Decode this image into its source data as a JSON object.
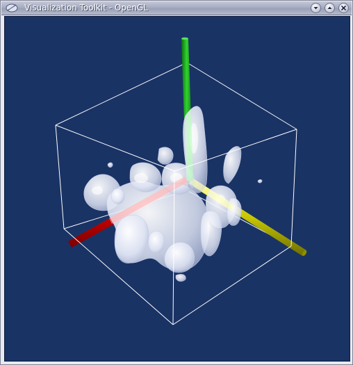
{
  "window": {
    "title": "Visualization Toolkit - OpenGL",
    "app_icon": "vtk-feather-icon",
    "controls": [
      {
        "name": "minimize",
        "icon": "chevron-down-icon"
      },
      {
        "name": "maximize",
        "icon": "chevron-up-icon"
      },
      {
        "name": "close",
        "icon": "close-icon"
      }
    ]
  },
  "scene": {
    "background_color": "#1a3365",
    "outline_color": "#ffffff",
    "axes": [
      {
        "name": "x-axis",
        "color": "#d40000"
      },
      {
        "name": "y-axis",
        "color": "#c8c800"
      },
      {
        "name": "z-axis",
        "color": "#14a014"
      }
    ],
    "isosurface_color": "#e8ecf8"
  }
}
